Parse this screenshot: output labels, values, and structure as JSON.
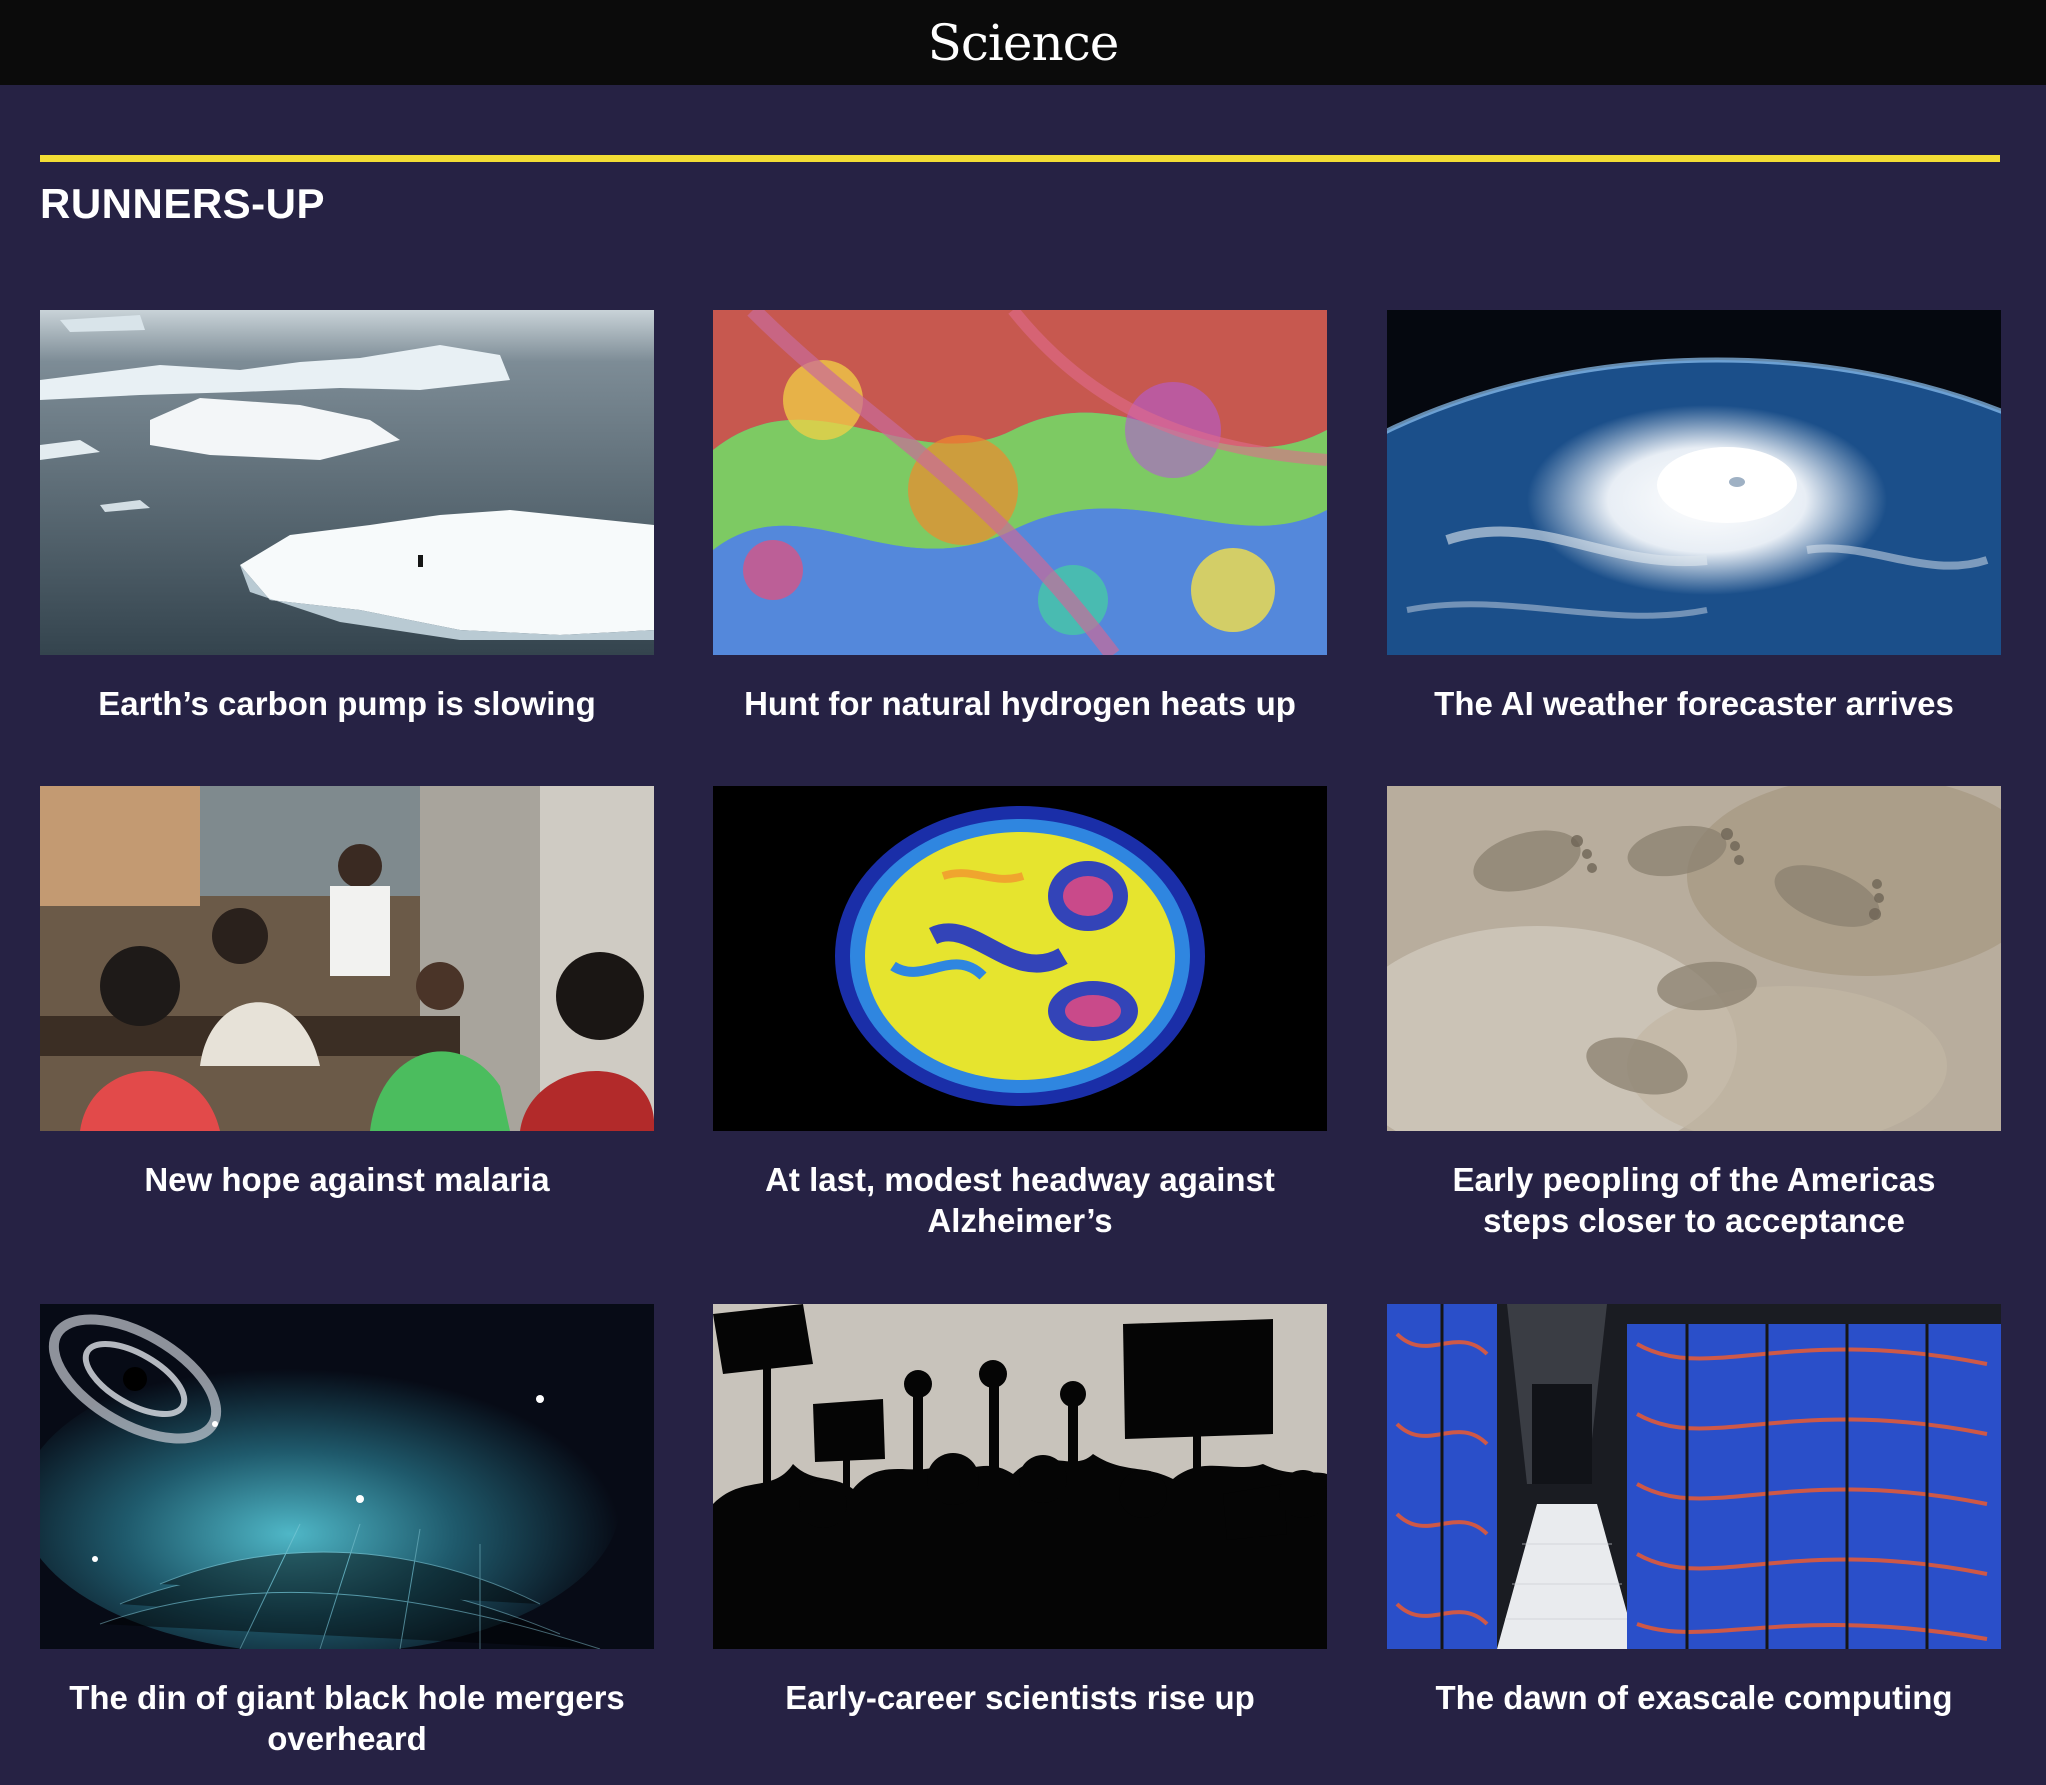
{
  "header": {
    "logo": "Science"
  },
  "section": {
    "title": "RUNNERS-UP"
  },
  "cards": [
    {
      "caption": "Earth’s carbon pump is slowing"
    },
    {
      "caption": "Hunt for natural hydrogen heats up"
    },
    {
      "caption": "The AI weather forecaster arrives"
    },
    {
      "caption": "New hope against malaria"
    },
    {
      "caption": "At last, modest headway against Alzheimer’s"
    },
    {
      "caption": "Early peopling of the Americas steps closer to acceptance"
    },
    {
      "caption": "The din of giant black hole mergers overheard"
    },
    {
      "caption": "Early-career scientists rise up"
    },
    {
      "caption": "The dawn of exascale computing"
    }
  ],
  "colors": {
    "background": "#262244",
    "header": "#0b0b0b",
    "accent_rule": "#f2dd35"
  }
}
